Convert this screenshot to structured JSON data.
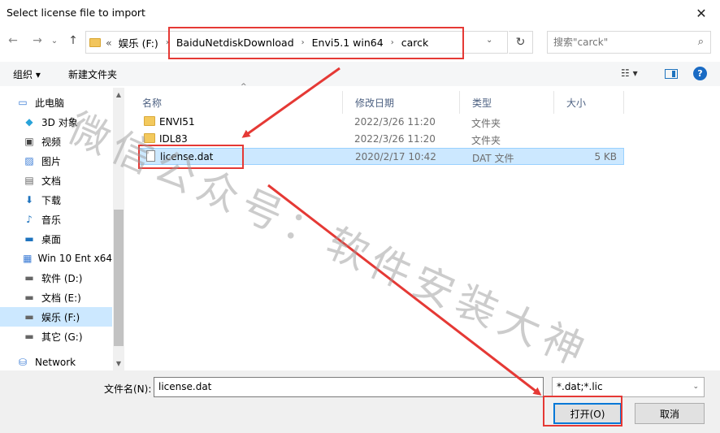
{
  "window": {
    "title": "Select license file to import",
    "close_glyph": "✕"
  },
  "nav": {
    "back": "←",
    "forward": "→",
    "recent": "⌄",
    "up": "↑"
  },
  "address": {
    "overflow": "«",
    "root": "娱乐 (F:)",
    "crumbs": [
      "BaiduNetdiskDownload",
      "Envi5.1 win64",
      "carck"
    ],
    "separator": "›",
    "dropdown": "⌄",
    "refresh": "↻"
  },
  "search": {
    "placeholder": "搜索\"carck\"",
    "icon": "⌕"
  },
  "commands": {
    "organize": "组织 ▾",
    "new_folder": "新建文件夹",
    "view": "☷ ▾",
    "help": "?"
  },
  "sidebar": {
    "items": [
      {
        "label": "此电脑",
        "icon": "computer-icon",
        "glyph": "▭"
      },
      {
        "label": "3D 对象",
        "icon": "3d-objects-icon",
        "glyph": "◆"
      },
      {
        "label": "视频",
        "icon": "video-icon",
        "glyph": "▣"
      },
      {
        "label": "图片",
        "icon": "pictures-icon",
        "glyph": "▨"
      },
      {
        "label": "文档",
        "icon": "documents-icon",
        "glyph": "▤"
      },
      {
        "label": "下载",
        "icon": "downloads-icon",
        "glyph": "⬇"
      },
      {
        "label": "音乐",
        "icon": "music-icon",
        "glyph": "♪"
      },
      {
        "label": "桌面",
        "icon": "desktop-icon",
        "glyph": "▬"
      },
      {
        "label": "Win 10 Ent x64",
        "icon": "drive-c-icon",
        "glyph": "▦"
      },
      {
        "label": "软件 (D:)",
        "icon": "drive-d-icon",
        "glyph": "▬"
      },
      {
        "label": "文档 (E:)",
        "icon": "drive-e-icon",
        "glyph": "▬"
      },
      {
        "label": "娱乐 (F:)",
        "icon": "drive-f-icon",
        "glyph": "▬"
      },
      {
        "label": "其它 (G:)",
        "icon": "drive-g-icon",
        "glyph": "▬"
      },
      {
        "label": "Network",
        "icon": "network-icon",
        "glyph": "⛁"
      }
    ],
    "selected_index": 11
  },
  "columns": {
    "name": "名称",
    "modified": "修改日期",
    "type": "类型",
    "size": "大小",
    "sort_arrow": "^"
  },
  "files": [
    {
      "name": "ENVI51",
      "modified": "2022/3/26 11:20",
      "type": "文件夹",
      "size": "",
      "kind": "folder"
    },
    {
      "name": "IDL83",
      "modified": "2022/3/26 11:20",
      "type": "文件夹",
      "size": "",
      "kind": "folder"
    },
    {
      "name": "license.dat",
      "modified": "2020/2/17 10:42",
      "type": "DAT 文件",
      "size": "5 KB",
      "kind": "file"
    }
  ],
  "selected_file_index": 2,
  "footer": {
    "filename_label": "文件名(N):",
    "filename_value": "license.dat",
    "filter_value": "*.dat;*.lic",
    "filter_arrow": "⌄",
    "open_label": "打开(O)",
    "cancel_label": "取消"
  },
  "watermark": {
    "text": "微信公众号：软件安装大神"
  },
  "colors": {
    "annotation": "#e53935",
    "selection": "#cce8ff",
    "accent": "#0078d7"
  }
}
